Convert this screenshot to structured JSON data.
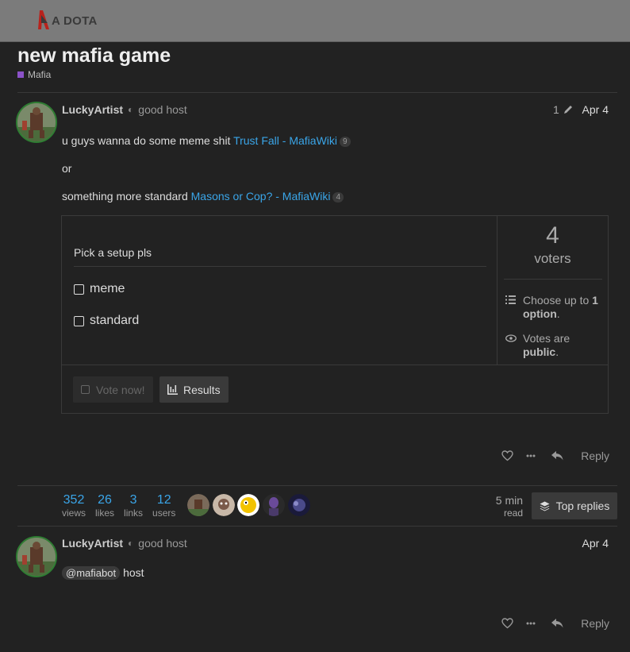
{
  "header": {
    "logo_text": "A DOTA"
  },
  "topic": {
    "title": "new mafia game",
    "category": "Mafia"
  },
  "post1": {
    "username": "LuckyArtist",
    "user_title": "good host",
    "edit_count": "1",
    "date": "Apr 4",
    "line1_text": "u guys wanna do some meme shit ",
    "line1_link": "Trust Fall - MafiaWiki",
    "line1_clicks": "9",
    "line2_text": "or",
    "line3_text": "something more standard ",
    "line3_link": "Masons or Cop? - MafiaWiki",
    "line3_clicks": "4",
    "poll": {
      "title": "Pick a setup pls",
      "options": [
        "meme",
        "standard"
      ],
      "voters_count": "4",
      "voters_label": "voters",
      "choose_prefix": "Choose up to ",
      "choose_bold": "1 option",
      "choose_suffix": ".",
      "votes_prefix": "Votes are ",
      "votes_bold": "public",
      "votes_suffix": ".",
      "vote_button": "Vote now!",
      "results_button": "Results"
    },
    "reply_label": "Reply"
  },
  "topic_stats": {
    "views": "352",
    "views_label": "views",
    "likes": "26",
    "likes_label": "likes",
    "links": "3",
    "links_label": "links",
    "users": "12",
    "users_label": "users",
    "read_time": "5 min",
    "read_label": "read",
    "top_replies": "Top replies"
  },
  "post2": {
    "username": "LuckyArtist",
    "user_title": "good host",
    "date": "Apr 4",
    "mention": "@mafiabot",
    "text": "host",
    "reply_label": "Reply"
  },
  "colors": {
    "link": "#3aa5e8",
    "category": "#8b52c8",
    "avatar_border": "#2e7d32"
  }
}
